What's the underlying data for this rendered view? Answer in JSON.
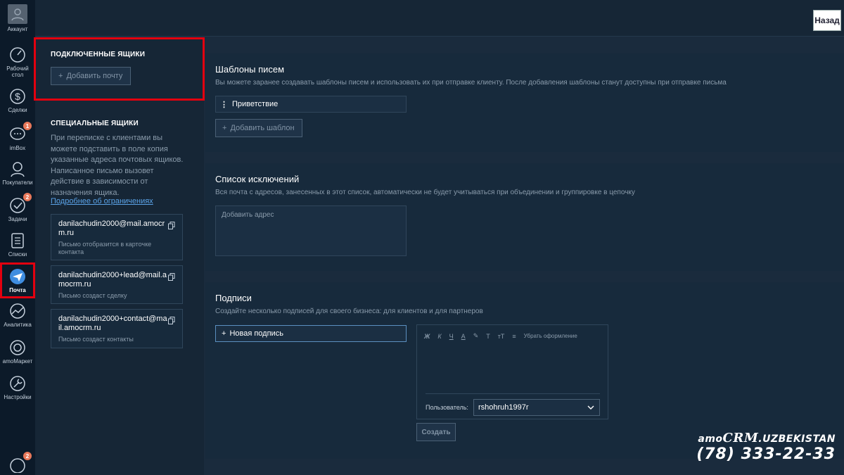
{
  "header": {
    "back_label": "Назад"
  },
  "nav": {
    "account": "Аккаунт",
    "items": [
      {
        "label": "Рабочий\nстол",
        "icon": "dashboard-icon"
      },
      {
        "label": "Сделки",
        "icon": "dollar-icon"
      },
      {
        "label": "imBox",
        "icon": "chat-icon",
        "badge": "1"
      },
      {
        "label": "Покупатели",
        "icon": "customers-icon"
      },
      {
        "label": "Задачи",
        "icon": "check-icon",
        "badge": "2"
      },
      {
        "label": "Списки",
        "icon": "lists-icon"
      },
      {
        "label": "Почта",
        "icon": "mail-icon"
      },
      {
        "label": "Аналитика",
        "icon": "analytics-icon"
      },
      {
        "label": "amoМаркет",
        "icon": "market-icon"
      },
      {
        "label": "Настройки",
        "icon": "settings-icon"
      }
    ],
    "bottom_badge": "2"
  },
  "left_panel": {
    "connected_heading": "ПОДКЛЮЧЕННЫЕ ЯЩИКИ",
    "add_mail_label": "Добавить почту",
    "special_heading": "СПЕЦИАЛЬНЫЕ ЯЩИКИ",
    "special_desc": "При переписке с клиентами вы можете подставить в поле копия указанные адреса почтовых ящиков. Написанное письмо вызовет действие в зависимости от назначения ящика.",
    "limits_link": "Подробнее об ограничениях",
    "mailboxes": [
      {
        "address": "danilachudin2000@mail.amocrm.ru",
        "note": "Письмо отобразится в карточке контакта"
      },
      {
        "address": "danilachudin2000+lead@mail.amocrm.ru",
        "note": "Письмо создаст сделку"
      },
      {
        "address": "danilachudin2000+contact@mail.amocrm.ru",
        "note": "Письмо создаст контакты"
      }
    ]
  },
  "templates": {
    "title": "Шаблоны писем",
    "desc": "Вы можете заранее создавать шаблоны писем и использовать их при отправке клиенту. После добавления шаблоны станут доступны при отправке письма",
    "items": [
      "Приветствие"
    ],
    "add_label": "Добавить шаблон"
  },
  "exclusions": {
    "title": "Список исключений",
    "desc": "Вся почта с адресов, занесенных в этот список, автоматически не будет учитываться при объединении и группировке в цепочку",
    "placeholder": "Добавить адрес"
  },
  "signatures": {
    "title": "Подписи",
    "desc": "Создайте несколько подписей для своего бизнеса: для клиентов и для партнеров",
    "new_label": "Новая подпись",
    "toolbar": {
      "bold": "Ж",
      "italic": "К",
      "underline": "Ч",
      "color": "А",
      "highlight": "✎",
      "font": "Т",
      "size": "тТ",
      "align": "≡",
      "clear": "Убрать оформление"
    },
    "user_label": "Пользователь:",
    "user_value": "rshohruh1997r",
    "create_label": "Создать"
  },
  "watermark": {
    "brand_prefix": "amo",
    "brand_crm": "CRM",
    "brand_suffix": ".UZBEKISTAN",
    "phone": "(78) 333-22-33"
  }
}
